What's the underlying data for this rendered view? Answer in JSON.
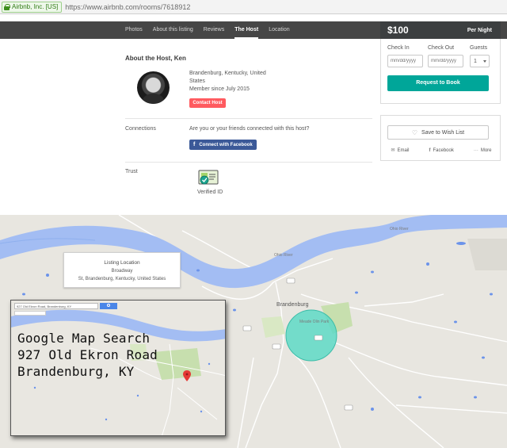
{
  "browser": {
    "secure_label": "Airbnb, Inc. [US]",
    "url": "https://www.airbnb.com/rooms/7618912"
  },
  "nav": {
    "tabs": [
      "Photos",
      "About this listing",
      "Reviews",
      "The Host",
      "Location"
    ],
    "active_tab": "The Host"
  },
  "pricing": {
    "price": "$100",
    "per": "Per Night"
  },
  "host": {
    "title": "About the Host, Ken",
    "location_lines": [
      "Brandenburg, Kentucky, United",
      "States"
    ],
    "member_since": "Member since July 2015",
    "contact_label": "Contact Host"
  },
  "connections": {
    "label": "Connections",
    "question": "Are you or your friends connected with this host?",
    "facebook_label": "Connect with Facebook"
  },
  "trust": {
    "label": "Trust",
    "verified_label": "Verified ID"
  },
  "booking": {
    "check_in_label": "Check In",
    "check_out_label": "Check Out",
    "guests_label": "Guests",
    "check_in_placeholder": "mm/dd/yyyy",
    "check_out_placeholder": "mm/dd/yyyy",
    "guests_value": "1",
    "request_label": "Request to Book"
  },
  "share": {
    "wishlist_label": "Save to Wish List",
    "email_label": "Email",
    "facebook_label": "Facebook",
    "more_label": "More"
  },
  "map": {
    "info_title": "Listing Location",
    "info_street": "Broadway",
    "info_address": "St, Brandenburg, Kentucky, United States",
    "town_label": "Brandenburg",
    "park_label": "Meade Olin Park",
    "river_label_1": "Ohio River",
    "river_label_2": "Ohio River",
    "inset_search_text": "927 Old Ekron Road, Brandenburg, KY",
    "annotation_lines": [
      "Google Map Search",
      "927 Old Ekron Road",
      "Brandenburg, KY"
    ],
    "colors": {
      "river": "#a3bdf3",
      "circle": "#5ed9c5",
      "park": "#c7dfae"
    }
  }
}
